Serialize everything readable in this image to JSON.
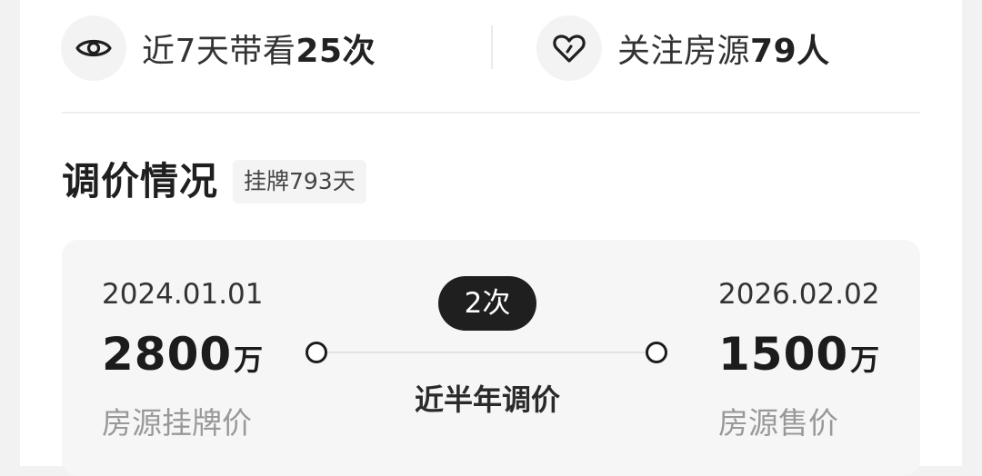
{
  "stats": {
    "views": {
      "prefix": "近7天带看",
      "value": "25次",
      "icon": "eye-icon"
    },
    "followers": {
      "prefix": "关注房源",
      "value": "79人",
      "icon": "heart-icon"
    }
  },
  "price_history": {
    "title": "调价情况",
    "listed_badge": "挂牌793天",
    "start": {
      "date": "2024.01.01",
      "price": "2800",
      "unit": "万",
      "label": "房源挂牌价"
    },
    "end": {
      "date": "2026.02.02",
      "price": "1500",
      "unit": "万",
      "label": "房源售价"
    },
    "adjust_count": "2次",
    "adjust_label": "近半年调价"
  }
}
